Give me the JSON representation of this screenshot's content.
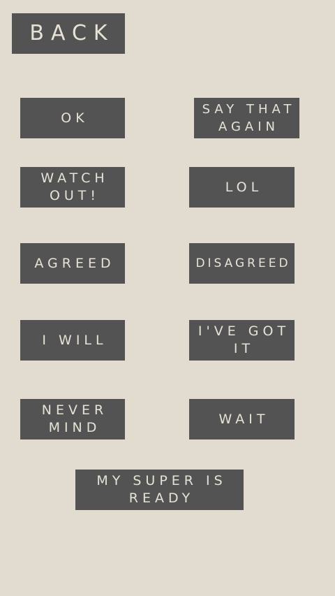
{
  "back_label": "BACK",
  "quick_chat": {
    "ok": "OK",
    "say_that_again": "SAY THAT\nAGAIN",
    "watch_out": "WATCH\nOUT!",
    "lol": "LOL",
    "agreed": "AGREED",
    "disagreed": "DISAGREED",
    "i_will": "I WILL",
    "ive_got_it": "I'VE GOT\nIT",
    "never_mind": "NEVER\nMIND",
    "wait": "WAIT",
    "my_super_is_ready": "MY SUPER IS\nREADY"
  },
  "colors": {
    "background": "#e1dccf",
    "button": "#545354",
    "button_text": "#e6e2d6"
  }
}
